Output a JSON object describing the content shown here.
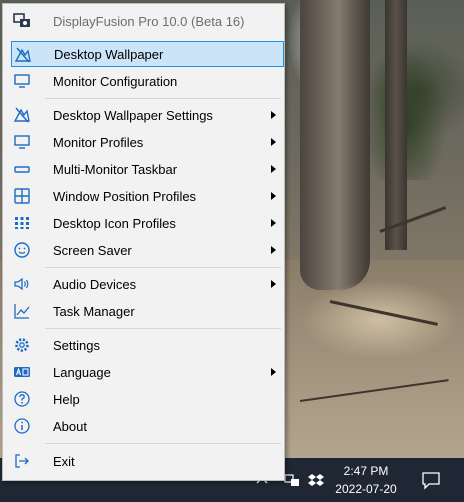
{
  "menu": {
    "header": "DisplayFusion Pro 10.0 (Beta 16)",
    "items": [
      {
        "label": "Desktop Wallpaper",
        "icon": "wallpaper-icon",
        "submenu": false,
        "selected": true
      },
      {
        "label": "Monitor Configuration",
        "icon": "monitor-icon",
        "submenu": false
      },
      {
        "label": "Desktop Wallpaper Settings",
        "icon": "wallpaper-settings-icon",
        "submenu": true
      },
      {
        "label": "Monitor Profiles",
        "icon": "monitor-profiles-icon",
        "submenu": true
      },
      {
        "label": "Multi-Monitor Taskbar",
        "icon": "taskbar-icon",
        "submenu": true
      },
      {
        "label": "Window Position Profiles",
        "icon": "window-position-icon",
        "submenu": true
      },
      {
        "label": "Desktop Icon Profiles",
        "icon": "desktop-icons-icon",
        "submenu": true
      },
      {
        "label": "Screen Saver",
        "icon": "screen-saver-icon",
        "submenu": true
      },
      {
        "label": "Audio Devices",
        "icon": "speaker-icon",
        "submenu": true
      },
      {
        "label": "Task Manager",
        "icon": "task-manager-icon",
        "submenu": false
      },
      {
        "label": "Settings",
        "icon": "gear-icon",
        "submenu": false
      },
      {
        "label": "Language",
        "icon": "language-icon",
        "submenu": true
      },
      {
        "label": "Help",
        "icon": "help-icon",
        "submenu": false
      },
      {
        "label": "About",
        "icon": "info-icon",
        "submenu": false
      },
      {
        "label": "Exit",
        "icon": "exit-icon",
        "submenu": false
      }
    ]
  },
  "taskbar": {
    "time": "2:47 PM",
    "date": "2022-07-20",
    "tray_icons": [
      "chevron-up-icon",
      "displayfusion-tray-icon",
      "dropbox-icon",
      "notification-icon"
    ]
  },
  "colors": {
    "menu_bg": "#f2f2f2",
    "selected_bg": "#cce4f7",
    "selected_border": "#1e90e6",
    "icon_blue": "#1c6cc4",
    "taskbar_bg": "#1f2735"
  }
}
